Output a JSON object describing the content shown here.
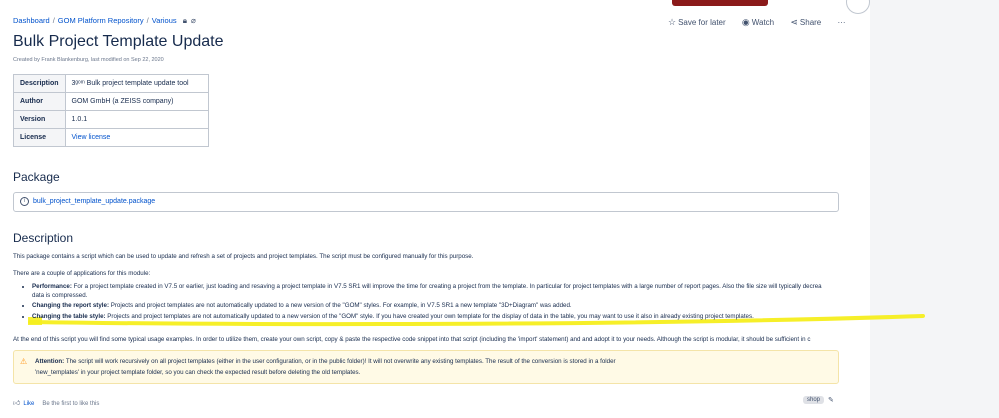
{
  "breadcrumb": {
    "items": [
      "Dashboard",
      "GOM Platform Repository",
      "Various"
    ]
  },
  "actions": {
    "save_for_later": "Save for later",
    "watch": "Watch",
    "share": "Share",
    "more": "···"
  },
  "page": {
    "title": "Bulk Project Template Update",
    "byline": "Created by Frank Blankenburg, last modified on Sep 22, 2020"
  },
  "meta_table": [
    {
      "key": "Description",
      "value": "3ᵍᵒᵐ Bulk project template update tool"
    },
    {
      "key": "Author",
      "value": "GOM GmbH (a ZEISS company)"
    },
    {
      "key": "Version",
      "value": "1.0.1"
    },
    {
      "key": "License",
      "value": "View license"
    }
  ],
  "package": {
    "heading": "Package",
    "link": "bulk_project_template_update.package"
  },
  "description": {
    "heading": "Description",
    "intro": "This package contains a script which can be used to update and refresh a set of projects and project templates. The script must be configured manually for this purpose.",
    "apps_intro": "There are a couple of applications for this module:",
    "apps": [
      {
        "title": "Performance:",
        "text": " For a project template created in V7.5 or earlier, just loading and resaving a project template in V7.5 SR1 will improve the time for creating a project from the template. In particular for project templates with a large number of report pages. Also the file size will typically decrea",
        "text2": "data is compressed."
      },
      {
        "title": "Changing the report style:",
        "text": " Projects and project templates are not automatically updated to a new version of the \"GOM\" styles. For example, in V7.5 SR1 a new template \"3D+Diagram\" was added."
      },
      {
        "title": "Changing the table style:",
        "text": " Projects and project templates are not automatically updated to a new version of the \"GOM\" style. If you have created your own template for the display of data in the table, you may want to use it also in already existing project templates."
      }
    ],
    "usage": "At the end of this script you will find some typical usage examples. In order to utilize them, create your own script, copy & paste the respective code snippet into that script (including the 'import' statement) and and adopt it to your needs. Although the script is modular, it should be sufficient in c"
  },
  "attention": {
    "label": "Attention:",
    "line1": " The script will work recursively on all project templates (either in  the user configuration, or in the public folder)! It will not overwrite any existing templates. The result of the conversion is stored in a folder",
    "line2": "'new_templates' in your project template folder, so you can check the expected result before deleting the old templates."
  },
  "footer": {
    "like": "Like",
    "first_to_like": "Be the first to like this",
    "label": "shop"
  },
  "colors": {
    "link": "#0052cc",
    "highlight": "#f5ee1e",
    "attention_bg": "#fffae6"
  }
}
